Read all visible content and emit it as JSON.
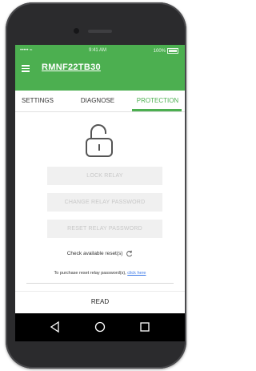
{
  "status_bar": {
    "carrier": "•••••  ≈",
    "time": "9:41 AM",
    "battery": "100%"
  },
  "app_bar": {
    "title": "RMNF22TB30"
  },
  "tabs": [
    {
      "label": "SETTINGS"
    },
    {
      "label": "DIAGNOSE"
    },
    {
      "label": "PROTECTION"
    }
  ],
  "active_tab": "PROTECTION",
  "buttons": {
    "lock_relay": "LOCK RELAY",
    "change_password": "CHANGE RELAY PASSWORD",
    "reset_password": "RESET RELAY PASSWORD"
  },
  "check_resets": "Check available reset(s)",
  "purchase": {
    "text": "To purchase reset relay password(s),",
    "link": "click here"
  },
  "read_label": "READ",
  "colors": {
    "accent": "#4caf50",
    "link": "#3b78e7",
    "disabled_bg": "#f0f0f0",
    "disabled_text": "#c7c7c7"
  },
  "icons": [
    "hamburger-menu-icon",
    "open-padlock-icon",
    "refresh-icon",
    "back-triangle-icon",
    "home-circle-icon",
    "recents-square-icon"
  ]
}
